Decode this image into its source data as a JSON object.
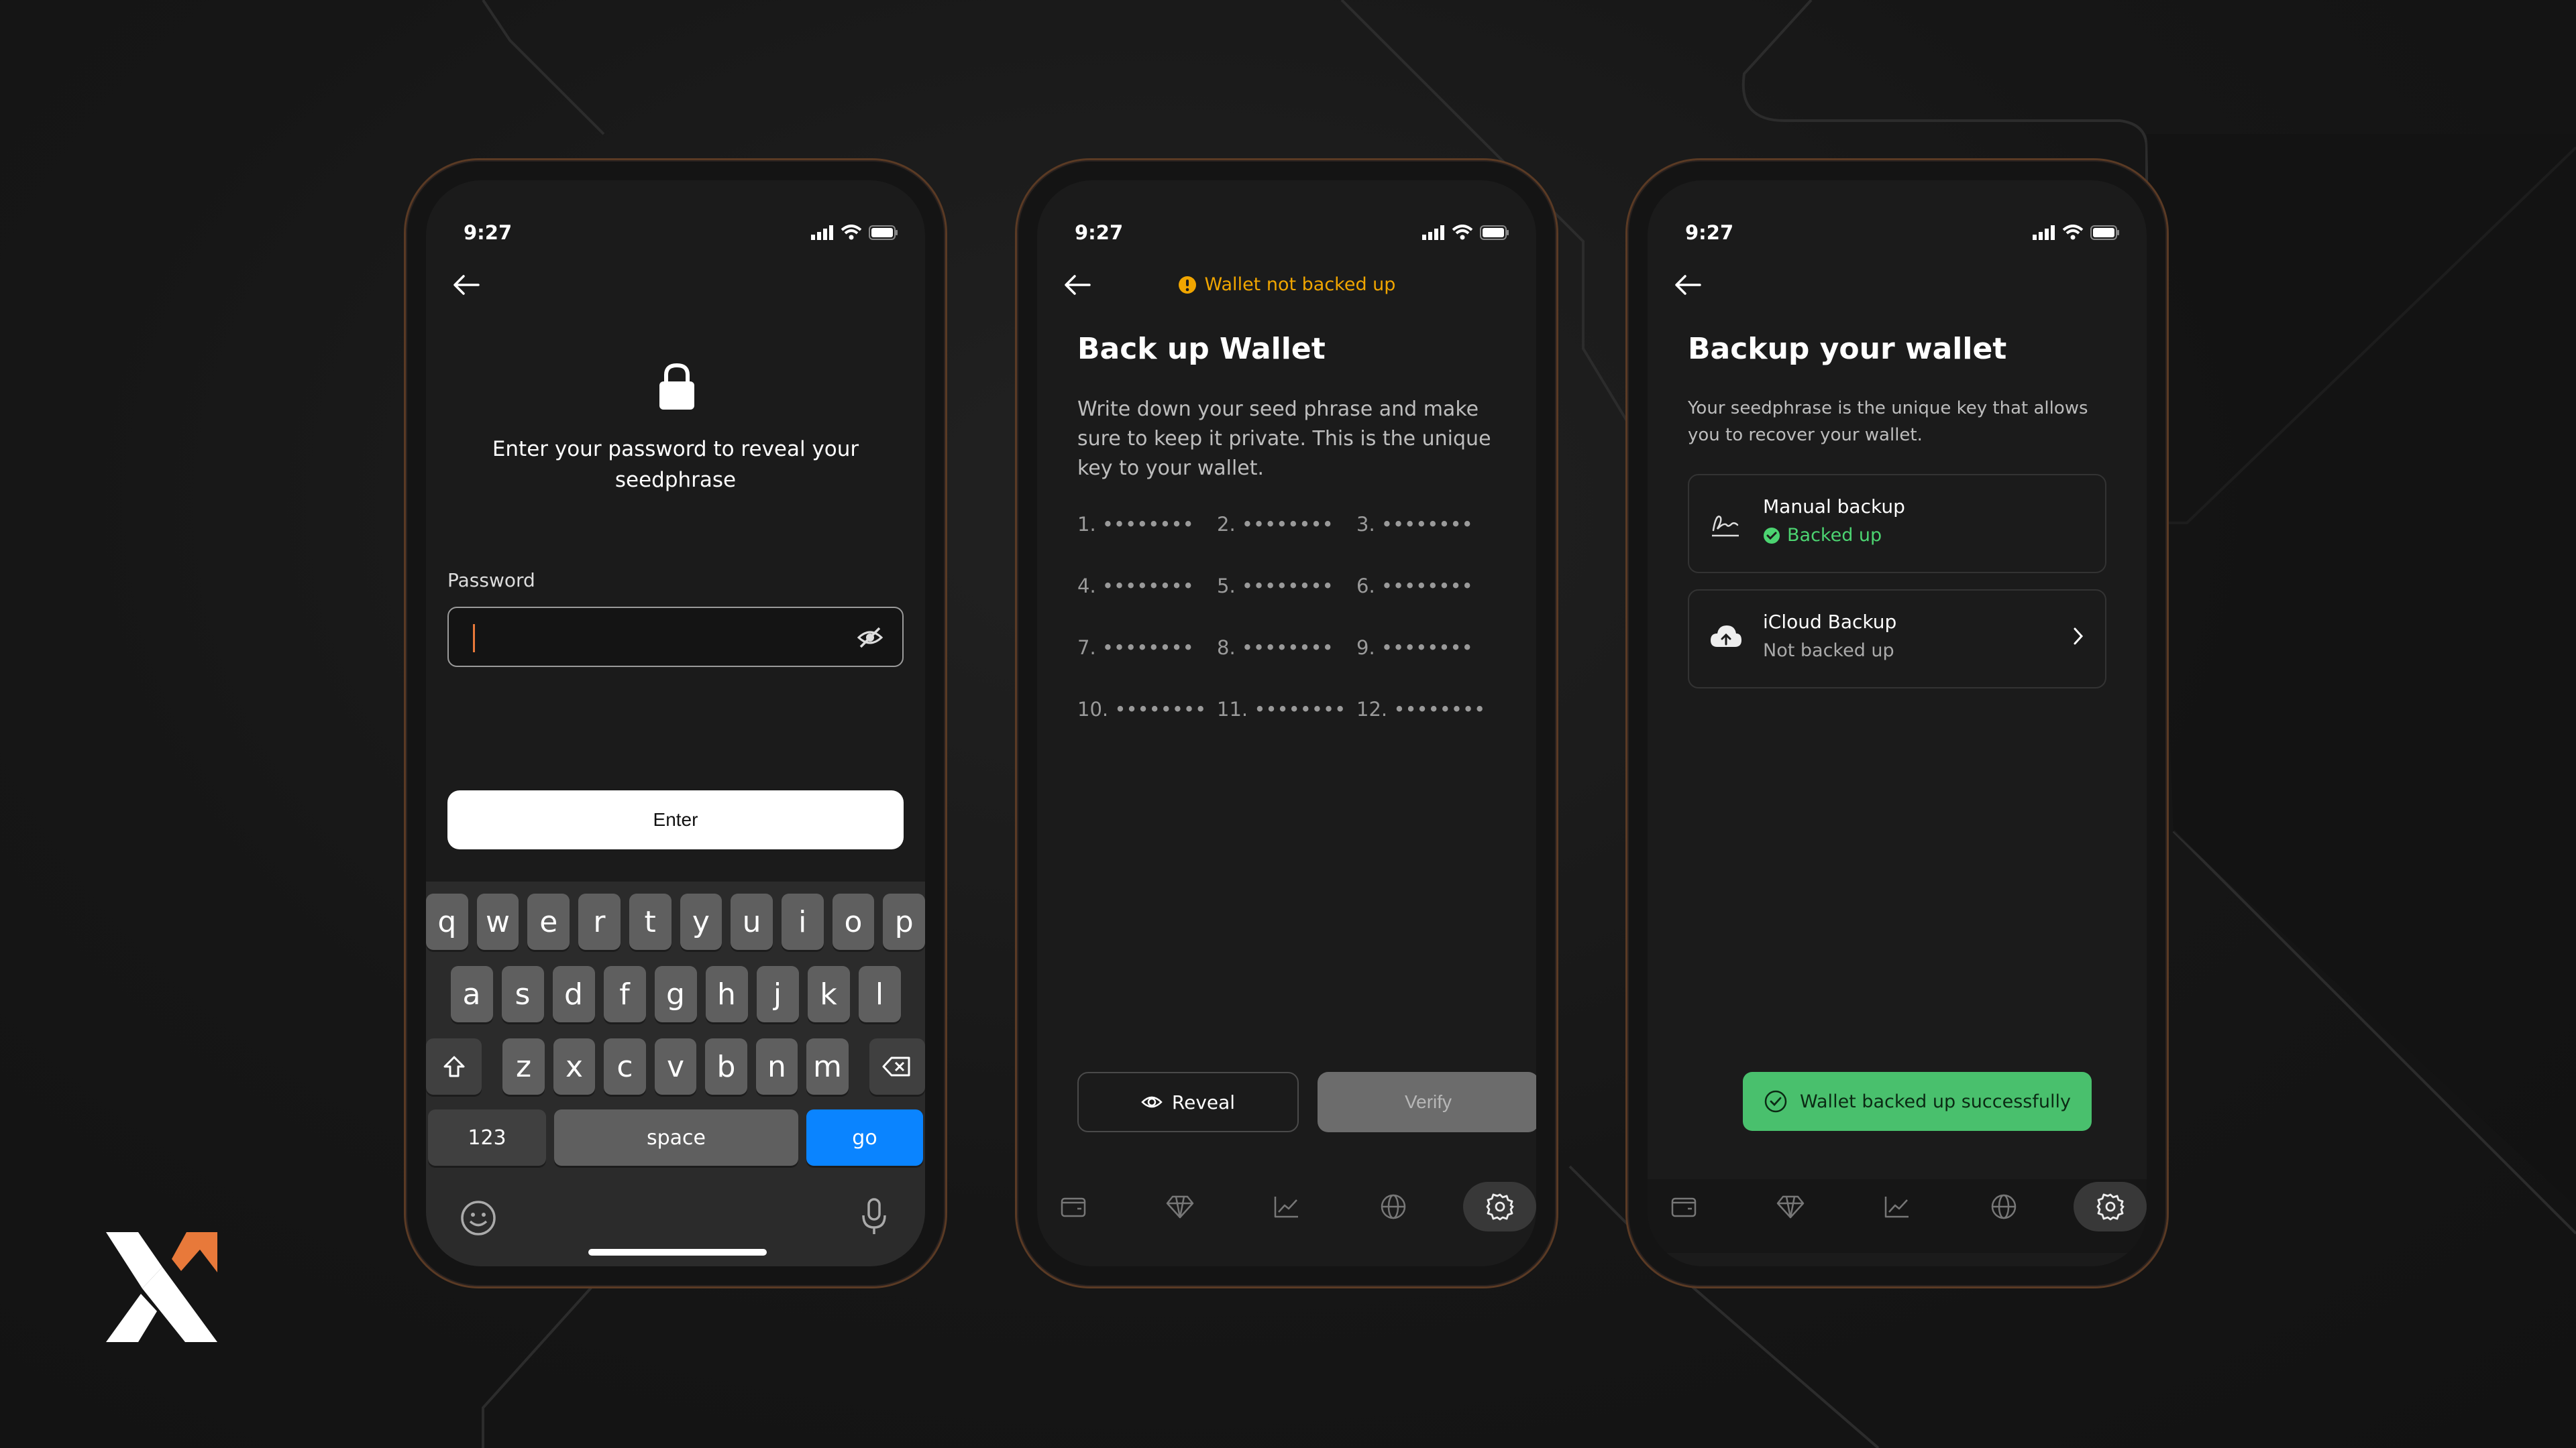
{
  "colors": {
    "accent": "#e8793a",
    "warning": "#f0a500",
    "success": "#49c06d",
    "ios_blue": "#0a84ff"
  },
  "status": {
    "time": "9:27"
  },
  "reveal_screen": {
    "message": "Enter your password to reveal your seedphrase",
    "password_label": "Password",
    "password_value": "",
    "enter_label": "Enter",
    "keyboard": {
      "row1": [
        "q",
        "w",
        "e",
        "r",
        "t",
        "y",
        "u",
        "i",
        "o",
        "p"
      ],
      "row2": [
        "a",
        "s",
        "d",
        "f",
        "g",
        "h",
        "j",
        "k",
        "l"
      ],
      "row3": [
        "z",
        "x",
        "c",
        "v",
        "b",
        "n",
        "m"
      ],
      "numbers_label": "123",
      "space_label": "space",
      "go_label": "go"
    }
  },
  "backup_screen": {
    "banner": "Wallet not backed up",
    "title": "Back up Wallet",
    "description": "Write down your seed phrase and make sure to keep it private. This is the unique key to your wallet.",
    "seed_words": [
      "1. ••••••••",
      "2. ••••••••",
      "3. ••••••••",
      "4. ••••••••",
      "5. ••••••••",
      "6. ••••••••",
      "7. ••••••••",
      "8. ••••••••",
      "9. ••••••••",
      "10. ••••••••",
      "11. ••••••••",
      "12. ••••••••"
    ],
    "reveal_label": "Reveal",
    "verify_label": "Verify"
  },
  "settings_screen": {
    "title": "Backup your wallet",
    "description": "Your seedphrase is the unique key that allows you to recover your wallet.",
    "manual": {
      "title": "Manual backup",
      "status": "Backed up"
    },
    "icloud": {
      "title": "iCloud Backup",
      "status": "Not backed up"
    },
    "toast": "Wallet backed up successfully"
  },
  "tabbar": {
    "icons": [
      "wallet-icon",
      "diamond-icon",
      "chart-icon",
      "globe-icon",
      "settings-icon"
    ],
    "active": "settings-icon"
  }
}
